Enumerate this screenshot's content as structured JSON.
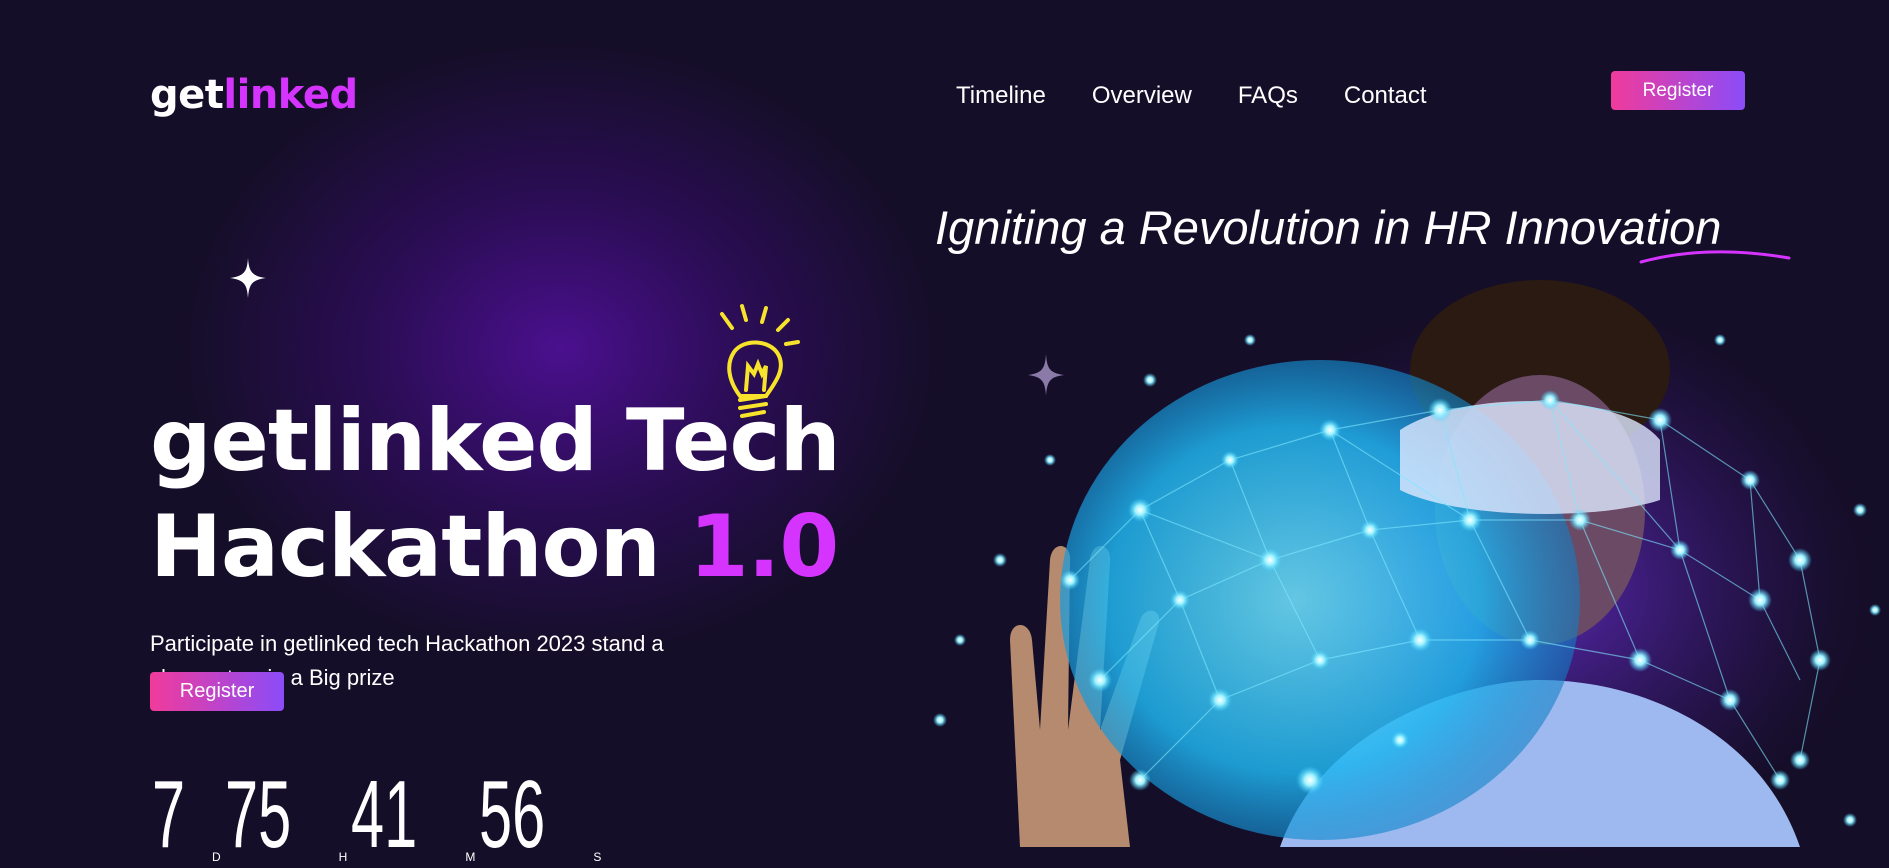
{
  "brand": {
    "logo_part1": "get",
    "logo_part2": "linked"
  },
  "nav": {
    "links": [
      "Timeline",
      "Overview",
      "FAQs",
      "Contact"
    ],
    "register_label": "Register"
  },
  "hero": {
    "tagline": "Igniting a Revolution in HR Innovation",
    "title_line1": "getlinked Tech",
    "title_line2": "Hackathon",
    "title_version": "1.0",
    "description": "Participate in getlinked tech Hackathon 2023 stand a chance to win a Big prize",
    "register_label": "Register"
  },
  "countdown": {
    "hours": "75",
    "hours_unit": "H",
    "minutes": "41",
    "minutes_unit": "M",
    "seconds": "56",
    "seconds_unit": "S",
    "days": "7",
    "days_unit": "D"
  },
  "colors": {
    "accent": "#d434fe",
    "background": "#150e28",
    "button_start": "#f13b9b",
    "button_end": "#8b4cf8",
    "bulb": "#f7e32b"
  },
  "icons": [
    "sparkle-icon",
    "lightbulb-icon",
    "sparkle-icon"
  ]
}
